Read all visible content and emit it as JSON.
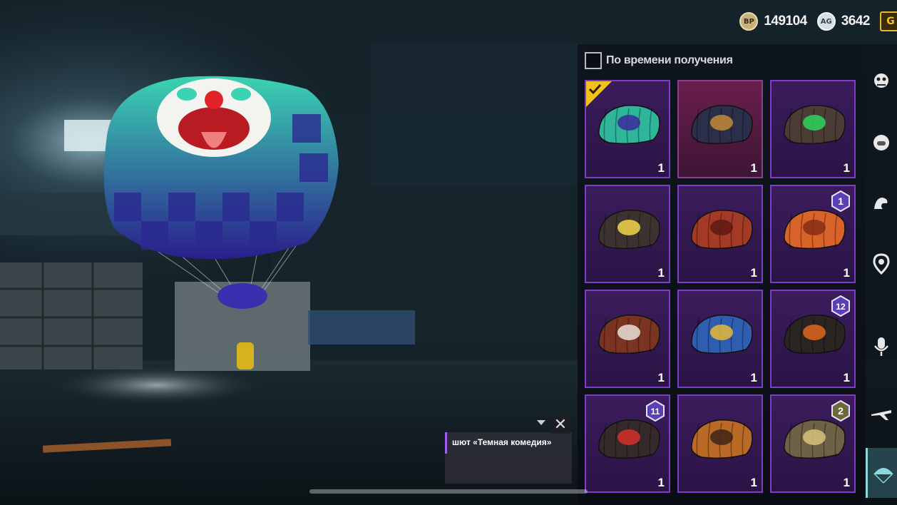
{
  "currency": {
    "bp_icon": "BP",
    "bp_value": "149104",
    "ag_icon": "AG",
    "ag_value": "3642",
    "g_badge": "G"
  },
  "sort": {
    "label": "По времени получения",
    "checked": false
  },
  "items": [
    {
      "name": "clown-parachute",
      "count": "1",
      "equipped": true,
      "selected": false,
      "badge": "",
      "colors": [
        "#2fb59a",
        "#3a2a9a"
      ]
    },
    {
      "name": "compass-parachute",
      "count": "1",
      "equipped": false,
      "selected": true,
      "badge": "",
      "colors": [
        "#2b2f4a",
        "#c28a3a"
      ]
    },
    {
      "name": "green-gem-parachute",
      "count": "1",
      "equipped": false,
      "selected": false,
      "badge": "",
      "colors": [
        "#4a3d36",
        "#2ed35a"
      ]
    },
    {
      "name": "moon-parachute",
      "count": "1",
      "equipped": false,
      "selected": false,
      "badge": "",
      "colors": [
        "#3c3330",
        "#f2d64a"
      ]
    },
    {
      "name": "red-parachute",
      "count": "1",
      "equipped": false,
      "selected": false,
      "badge": "",
      "colors": [
        "#a33a26",
        "#5e1a12"
      ]
    },
    {
      "name": "orange-parachute",
      "count": "1",
      "equipped": false,
      "selected": false,
      "badge": "1",
      "colors": [
        "#d8642c",
        "#8a2d14"
      ]
    },
    {
      "name": "skull-parachute",
      "count": "1",
      "equipped": false,
      "selected": false,
      "badge": "",
      "colors": [
        "#7b3322",
        "#e8e2d8"
      ]
    },
    {
      "name": "number-06-parachute",
      "count": "1",
      "equipped": false,
      "selected": false,
      "badge": "",
      "colors": [
        "#2f5db0",
        "#e7b83a"
      ]
    },
    {
      "name": "lion-parachute",
      "count": "1",
      "equipped": false,
      "selected": false,
      "badge": "12",
      "colors": [
        "#2a2422",
        "#e0651c"
      ]
    },
    {
      "name": "red-splash-parachute",
      "count": "1",
      "equipped": false,
      "selected": false,
      "badge": "11",
      "colors": [
        "#35292a",
        "#d5302c"
      ]
    },
    {
      "name": "amber-parachute",
      "count": "1",
      "equipped": false,
      "selected": false,
      "badge": "",
      "colors": [
        "#b96a26",
        "#3e2418"
      ]
    },
    {
      "name": "camo-parachute",
      "count": "1",
      "equipped": false,
      "selected": false,
      "badge": "2",
      "colors": [
        "#6e6148",
        "#d8c27a"
      ]
    }
  ],
  "nav": [
    "monster-icon",
    "face-icon",
    "muscle-icon",
    "location-icon",
    "microphone-icon",
    "plane-icon",
    "parachute-icon"
  ],
  "tooltip": {
    "text": "шют «Темная комедия»"
  }
}
